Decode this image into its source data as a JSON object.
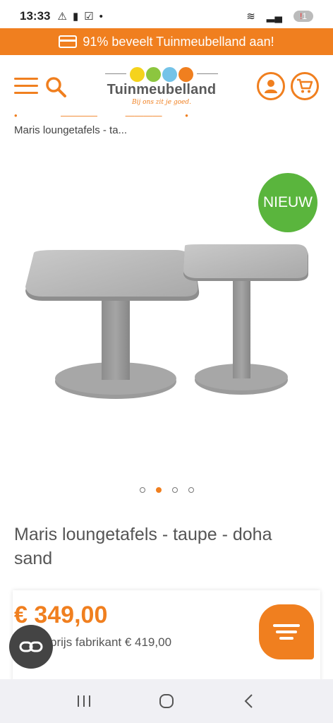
{
  "status_bar": {
    "time": "13:33",
    "battery_text": "1"
  },
  "promo": {
    "text": "91% beveelt Tuinmeubelland aan!"
  },
  "header": {
    "logo_name": "Tuinmeubelland",
    "logo_tagline": "Bij ons zit je goed.",
    "logo_colors": [
      "#f5d31c",
      "#8cc63f",
      "#74c3e8",
      "#f07f1f"
    ]
  },
  "breadcrumb": {
    "current": "Maris loungetafels - ta..."
  },
  "gallery": {
    "badge": "NIEUW",
    "slide_count": 4,
    "active_slide": 2
  },
  "product": {
    "title": "Maris loungetafels - taupe - doha sand",
    "price": "€ 349,00",
    "advice_price": "Adviesprijs fabrikant € 419,00"
  },
  "colors": {
    "accent": "#f07f1f",
    "badge": "#5ab53d"
  }
}
